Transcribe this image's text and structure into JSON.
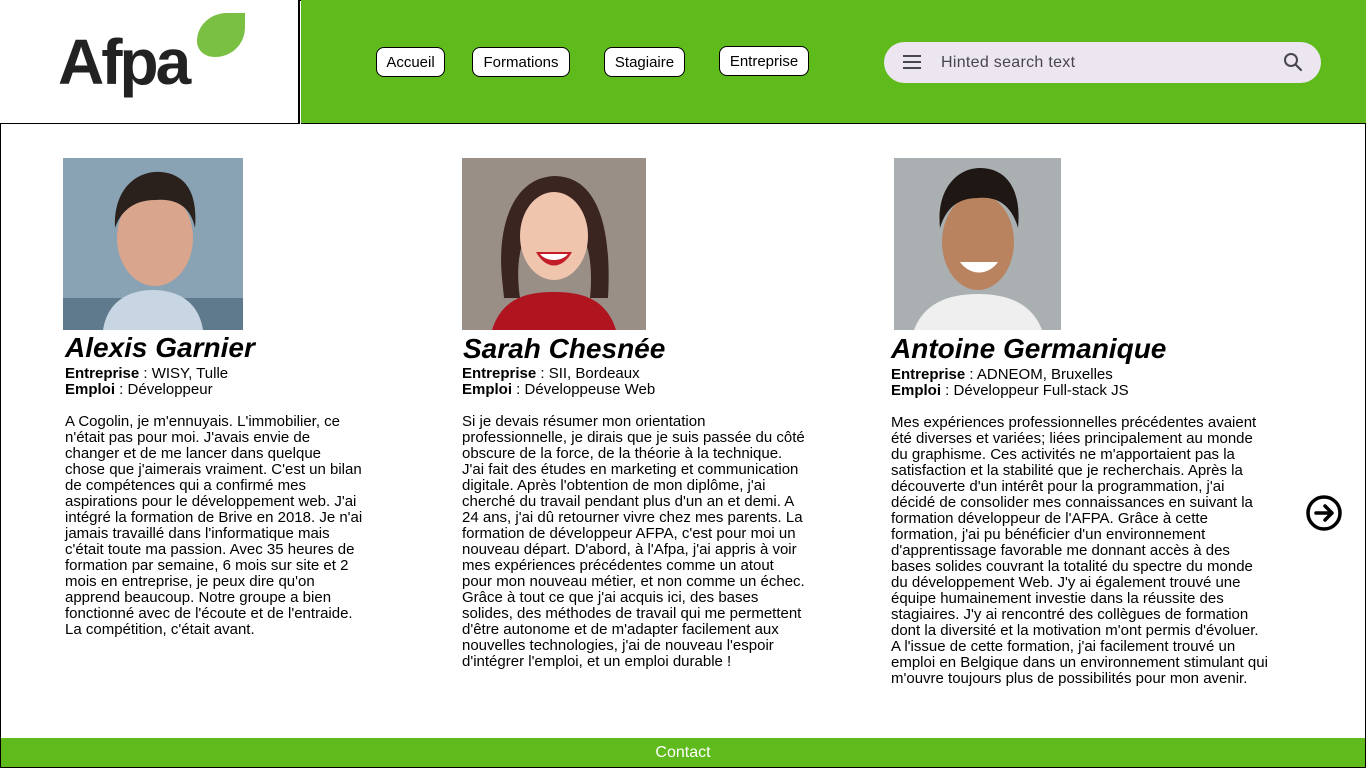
{
  "brand": {
    "logo_text": "Afpa",
    "primary_color": "#5fbb1c",
    "logo_leaf_color": "#7ac143"
  },
  "nav": {
    "items": [
      {
        "label": "Accueil"
      },
      {
        "label": "Formations"
      },
      {
        "label": "Stagiaire"
      },
      {
        "label": "Entreprise"
      }
    ]
  },
  "search": {
    "placeholder": "Hinted search text",
    "menu_icon": "menu-icon",
    "search_icon": "search-icon"
  },
  "testimonials": [
    {
      "name": "Alexis Garnier",
      "company_label": "Entreprise",
      "company": " : WISY, Tulle",
      "job_label": "Emploi",
      "job": " : Développeur",
      "bio": "A Cogolin, je m'ennuyais. L'immobilier, ce n'était pas pour moi. J'avais envie de changer et de me lancer dans quelque chose que j'aimerais vraiment. C'est un bilan de compétences qui a confirmé mes aspirations pour le développement web. J'ai intégré la formation de Brive en 2018. Je n'ai jamais travaillé dans l'informatique mais c'était toute ma passion. Avec 35 heures de formation par semaine, 6 mois sur site et 2 mois en entreprise, je peux dire qu'on apprend beaucoup. Notre groupe a bien fonctionné avec de l'écoute et de l'entraide. La compétition, c'était avant."
    },
    {
      "name": "Sarah Chesnée",
      "company_label": "Entreprise",
      "company": " : SII, Bordeaux",
      "job_label": "Emploi",
      "job": " : Développeuse Web",
      "bio": "Si je devais résumer mon orientation professionnelle, je dirais que je suis passée du côté obscure de la force, de la théorie à la technique. J'ai fait des études en marketing et communication digitale. Après l'obtention de mon diplôme, j'ai cherché du travail pendant plus d'un an et demi. A 24 ans, j'ai dû retourner vivre chez mes parents. La formation de développeur AFPA, c'est pour moi un nouveau départ. D'abord, à l'Afpa, j'ai appris à voir mes expériences précédentes comme un atout pour mon nouveau métier, et non comme un échec. Grâce à tout ce que j'ai acquis ici, des bases solides, des méthodes de travail qui me permettent d'être autonome et de m'adapter facilement aux nouvelles technologies, j'ai de nouveau l'espoir d'intégrer l'emploi, et un emploi durable !"
    },
    {
      "name": "Antoine Germanique",
      "company_label": "Entreprise",
      "company": " : ADNEOM, Bruxelles",
      "job_label": "Emploi",
      "job": " : Développeur  Full-stack JS",
      "bio": "Mes expériences professionnelles précédentes avaient été diverses et variées; liées principalement au monde du graphisme. Ces activités ne m'apportaient pas la satisfaction et la stabilité que je recherchais. Après la découverte d'un intérêt pour la programmation, j'ai décidé de consolider mes connaissances en suivant la formation développeur de l'AFPA. Grâce à cette formation, j'ai pu bénéficier d'un environnement d'apprentissage favorable me donnant accès à des bases solides couvrant la totalité du spectre du monde du développement Web. J'y ai également trouvé une équipe humainement investie dans la réussite des stagiaires. J'y ai rencontré des collègues de formation dont la diversité et la motivation m'ont permis d'évoluer. A l'issue de cette formation, j'ai facilement trouvé un emploi en Belgique dans un environnement stimulant qui m'ouvre toujours plus de possibilités pour mon avenir."
    }
  ],
  "carousel": {
    "next_icon": "arrow-right-circle-icon"
  },
  "footer": {
    "label": "Contact"
  }
}
